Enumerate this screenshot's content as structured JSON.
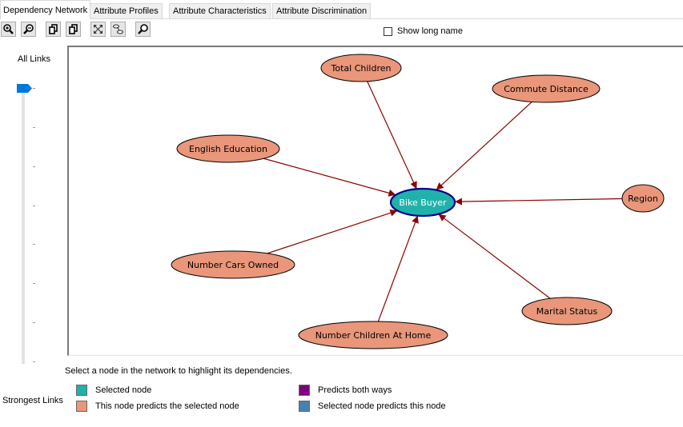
{
  "tabs": [
    {
      "label": "Dependency Network",
      "active": true
    },
    {
      "label": "Attribute Profiles",
      "active": false
    },
    {
      "label": "Attribute Characteristics",
      "active": false
    },
    {
      "label": "Attribute Discrimination",
      "active": false
    }
  ],
  "toolbar": {
    "buttons": [
      {
        "name": "zoom-in",
        "icon": "zoom-in-icon"
      },
      {
        "name": "zoom-out",
        "icon": "zoom-out-icon"
      },
      {
        "name": "copy-graph-view",
        "icon": "copy-icon"
      },
      {
        "name": "copy-entire-graph",
        "icon": "copy-icon"
      },
      {
        "name": "scale-to-fit",
        "icon": "fit-to-window-icon"
      },
      {
        "name": "center-graph",
        "icon": "center-graph-icon"
      },
      {
        "name": "find-node",
        "icon": "find-icon"
      }
    ],
    "show_long_name": {
      "label": "Show long name",
      "checked": false
    }
  },
  "slider": {
    "label": "All Links",
    "position_fraction": 0.0,
    "ticks": 8
  },
  "network": {
    "selected_node": "Bike Buyer",
    "colors": {
      "selected_fill": "#20b2aa",
      "selected_stroke": "#00008b",
      "predictor_fill": "#e9967a",
      "edge": "#8b0000"
    },
    "nodes": [
      {
        "id": "bike-buyer",
        "label": "Bike Buyer",
        "role": "selected"
      },
      {
        "id": "total-children",
        "label": "Total Children",
        "role": "predictor"
      },
      {
        "id": "commute-distance",
        "label": "Commute Distance",
        "role": "predictor"
      },
      {
        "id": "english-education",
        "label": "English Education",
        "role": "predictor"
      },
      {
        "id": "region",
        "label": "Region",
        "role": "predictor"
      },
      {
        "id": "number-cars-owned",
        "label": "Number Cars Owned",
        "role": "predictor"
      },
      {
        "id": "marital-status",
        "label": "Marital Status",
        "role": "predictor"
      },
      {
        "id": "number-children-at-home",
        "label": "Number Children At Home",
        "role": "predictor"
      }
    ],
    "edges": [
      {
        "from": "total-children",
        "to": "bike-buyer"
      },
      {
        "from": "commute-distance",
        "to": "bike-buyer"
      },
      {
        "from": "english-education",
        "to": "bike-buyer"
      },
      {
        "from": "region",
        "to": "bike-buyer"
      },
      {
        "from": "number-cars-owned",
        "to": "bike-buyer"
      },
      {
        "from": "marital-status",
        "to": "bike-buyer"
      },
      {
        "from": "number-children-at-home",
        "to": "bike-buyer"
      }
    ]
  },
  "hint": "Select a node in the network to highlight its dependencies.",
  "legend": {
    "title": "Strongest Links",
    "items": [
      {
        "label": "Selected node",
        "color": "#20b2aa"
      },
      {
        "label": "This node predicts the selected node",
        "color": "#e9967a"
      },
      {
        "label": "Predicts both ways",
        "color": "#800080"
      },
      {
        "label": "Selected node predicts this node",
        "color": "#4682b4"
      }
    ]
  }
}
